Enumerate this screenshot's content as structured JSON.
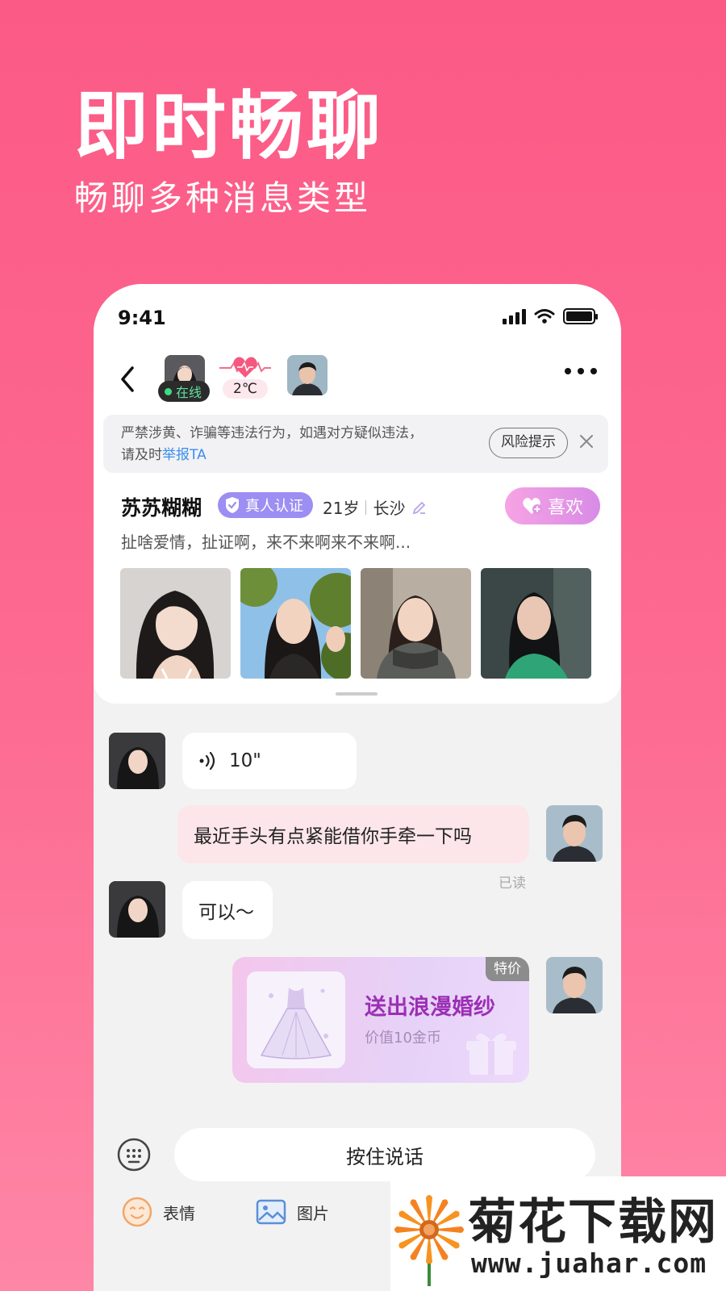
{
  "hero": {
    "title": "即时畅聊",
    "subtitle": "畅聊多种消息类型"
  },
  "status_bar": {
    "time": "9:41"
  },
  "chat_header": {
    "online_label": "在线",
    "temperature": "2℃"
  },
  "warning": {
    "text_line1": "严禁涉黄、诈骗等违法行为，如遇对方疑似违法，",
    "text_line2_prefix": "请及时",
    "report_link": "举报TA",
    "risk_button": "风险提示"
  },
  "profile": {
    "name": "苏苏糊糊",
    "verify_label": "真人认证",
    "age": "21岁",
    "city": "长沙",
    "like_button": "喜欢",
    "bio": "扯啥爱情，扯证啊，来不来啊来不来啊..."
  },
  "messages": [
    {
      "from": "her",
      "type": "voice",
      "text": "10\""
    },
    {
      "from": "me",
      "type": "text",
      "text": "最近手头有点紧能借你手牵一下吗",
      "status": "已读"
    },
    {
      "from": "her",
      "type": "text",
      "text": "可以～"
    },
    {
      "from": "me",
      "type": "gift",
      "title": "送出浪漫婚纱",
      "subtitle": "价值10金币",
      "tag": "特价"
    }
  ],
  "input": {
    "hold_to_talk": "按住说话",
    "tools": [
      {
        "icon": "emoji-icon",
        "label": "表情"
      },
      {
        "icon": "image-icon",
        "label": "图片"
      }
    ]
  },
  "watermark": {
    "brand": "菊花下载网",
    "url": "www.juahar.com"
  },
  "colors": {
    "background": "#fb5a86",
    "verify_badge": "#9c8ef2",
    "like_button": "#e195e5",
    "link": "#3b8ef0",
    "gift_title": "#9b2fb5",
    "online_dot": "#3ddc84"
  }
}
